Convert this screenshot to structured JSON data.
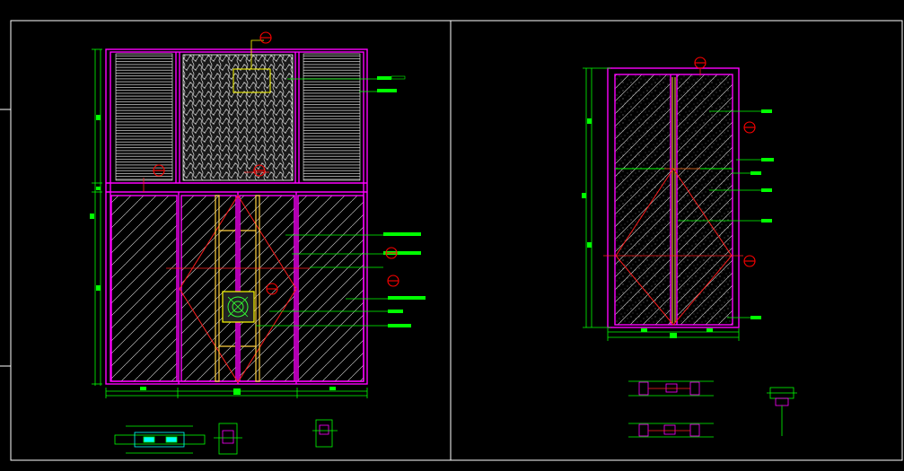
{
  "drawing": {
    "background": "#000000",
    "colors": {
      "frame": "#ffffff",
      "structure": "#ff00ff",
      "dimension": "#00ff00",
      "hatch": "#ffffff",
      "pattern_box": "#ffff00",
      "diamond": "#ff2020",
      "handle": "#ffd040",
      "section_marker": "#ff0000"
    },
    "left_elevation": {
      "name": "double-door-elevation",
      "note_tags": [
        "",
        "",
        "",
        "",
        "",
        "",
        "",
        "",
        "",
        ""
      ]
    },
    "right_elevation": {
      "name": "single-door-elevation",
      "note_tags": [
        "",
        "",
        "",
        "",
        "",
        "",
        "",
        ""
      ]
    },
    "section_markers": [
      "",
      "",
      "",
      "",
      "",
      "",
      "",
      ""
    ],
    "icons": [
      "section-marker-icon",
      "leader-arrow-icon"
    ]
  }
}
